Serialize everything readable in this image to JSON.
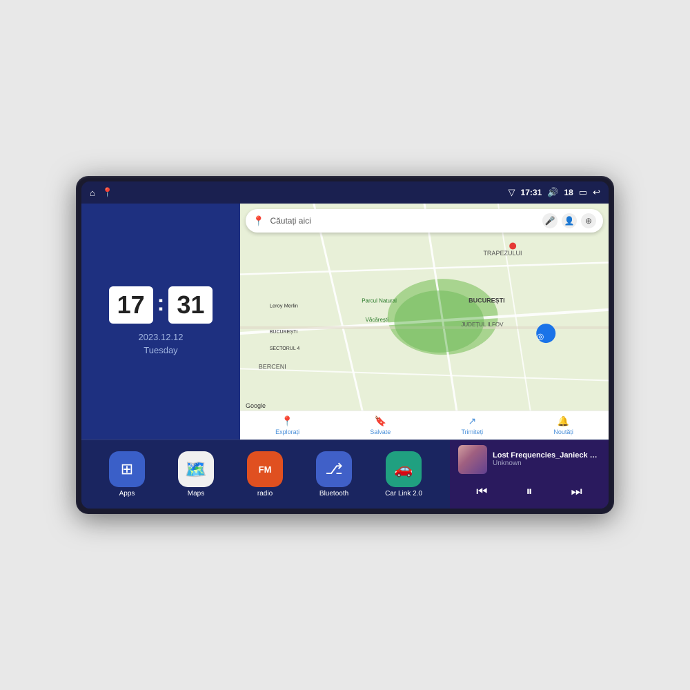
{
  "device": {
    "status_bar": {
      "left_icons": [
        "home-icon",
        "maps-pin-icon"
      ],
      "signal_icon": "▽",
      "time": "17:31",
      "volume_icon": "🔊",
      "battery_level": "18",
      "battery_icon": "🔋",
      "back_icon": "↩"
    },
    "clock_widget": {
      "hour": "17",
      "minute": "31",
      "date": "2023.12.12",
      "day": "Tuesday"
    },
    "map_widget": {
      "search_placeholder": "Căutați aici",
      "bottom_items": [
        {
          "icon": "📍",
          "label": "Explorați"
        },
        {
          "icon": "🔖",
          "label": "Salvate"
        },
        {
          "icon": "↗",
          "label": "Trimiteți"
        },
        {
          "icon": "🔔",
          "label": "Noutăți"
        }
      ],
      "map_labels": [
        "TRAPEZULUI",
        "BUCUREȘTI",
        "JUDEȚUL ILFOV",
        "BERCENI",
        "Parcul Natural Văcărești",
        "Leroy Merlin",
        "BUCUREȘTI SECTORUL 4"
      ],
      "google_attr": "Google"
    },
    "app_icons": [
      {
        "id": "apps",
        "label": "Apps",
        "icon": "⊞",
        "bg": "#3a5fc8"
      },
      {
        "id": "maps",
        "label": "Maps",
        "icon": "🗺",
        "bg": "#3a8c3a"
      },
      {
        "id": "radio",
        "label": "radio",
        "icon": "📻",
        "bg": "#e05020"
      },
      {
        "id": "bluetooth",
        "label": "Bluetooth",
        "icon": "🔷",
        "bg": "#4060c8"
      },
      {
        "id": "carlink",
        "label": "Car Link 2.0",
        "icon": "🚗",
        "bg": "#20a080"
      }
    ],
    "music_widget": {
      "title": "Lost Frequencies_Janieck Devy-...",
      "artist": "Unknown",
      "controls": {
        "prev": "⏮",
        "play_pause": "⏸",
        "next": "⏭"
      }
    }
  }
}
